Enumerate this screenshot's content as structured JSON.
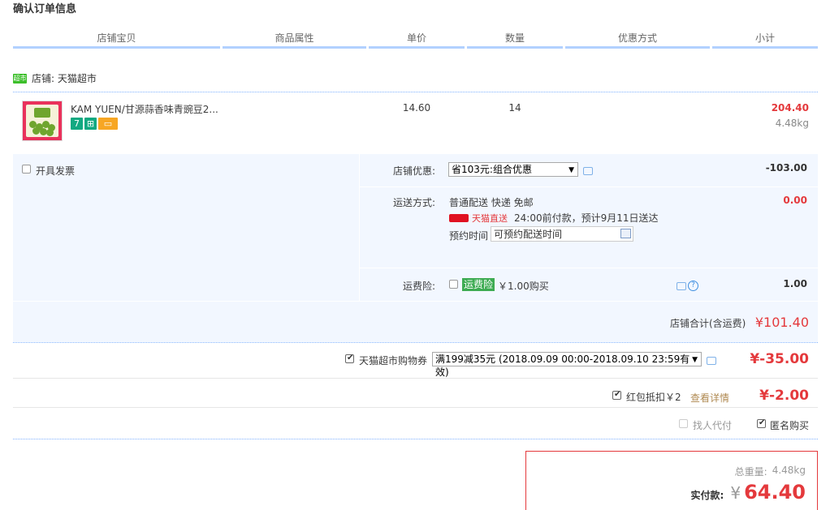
{
  "page_title": "确认订单信息",
  "columns": [
    "店铺宝贝",
    "商品属性",
    "单价",
    "数量",
    "优惠方式",
    "小计"
  ],
  "shop": {
    "badge": "超市",
    "label": "店铺: 天猫超市"
  },
  "product": {
    "name": "KAM YUEN/甘源蒜香味青豌豆2...",
    "tag1": "7",
    "unit_price": "14.60",
    "quantity": "14",
    "subtotal": "204.40",
    "weight": "4.48kg"
  },
  "invoice": {
    "label": "开具发票"
  },
  "shop_discount": {
    "label": "店铺优惠:",
    "selected": "省103元:组合优惠",
    "amount": "-103.00"
  },
  "shipping": {
    "label": "运送方式:",
    "method": "普通配送 快递 免邮",
    "tmall_direct": "天猫直送",
    "eta": "24:00前付款，预计9月11日送达",
    "appointment_label": "预约时间",
    "appointment_placeholder": "可预约配送时间",
    "amount": "0.00"
  },
  "insurance": {
    "label": "运费险:",
    "tag": "运费险",
    "price": "￥1.00购买",
    "amount": "1.00"
  },
  "shop_total": {
    "label": "店铺合计(含运费)",
    "amount": "¥101.40"
  },
  "coupon": {
    "label": "天猫超市购物券",
    "selected": "满199减35元 (2018.09.09 00:00-2018.09.10 23:59有效)",
    "amount": "¥-35.00"
  },
  "redpacket": {
    "label": "红包抵扣￥2",
    "link": "查看详情",
    "amount": "¥-2.00"
  },
  "options": {
    "proxy_pay": "找人代付",
    "anonymous": "匿名购买"
  },
  "summary": {
    "weight_label": "总重量:",
    "weight": "4.48kg",
    "pay_label": "实付款:",
    "currency": "¥",
    "pay_amount": "64.40"
  },
  "colors": {
    "accent_red": "#e4393c",
    "header_line": "#b2d1ff",
    "panel_bg": "#f2f7ff",
    "tmall_green": "#3dbf2b"
  }
}
